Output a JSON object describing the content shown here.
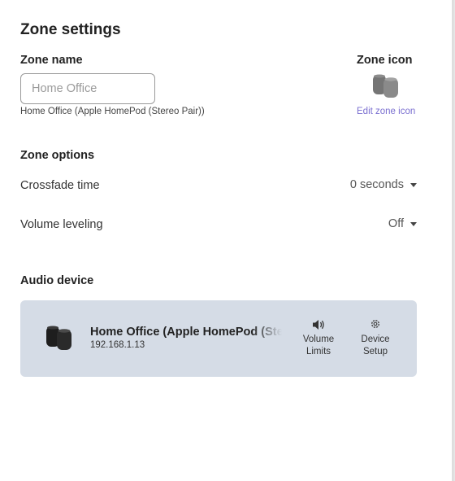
{
  "page": {
    "title": "Zone settings"
  },
  "zone_name": {
    "label": "Zone name",
    "placeholder": "Home Office",
    "hint": "Home Office (Apple HomePod (Stereo Pair))"
  },
  "zone_icon": {
    "label": "Zone icon",
    "icon": "homepod-pair-icon",
    "edit_link": "Edit zone icon"
  },
  "zone_options": {
    "label": "Zone options",
    "crossfade": {
      "label": "Crossfade time",
      "value": "0 seconds"
    },
    "volume_leveling": {
      "label": "Volume leveling",
      "value": "Off"
    }
  },
  "audio_device": {
    "label": "Audio device",
    "device": {
      "icon": "homepod-pair-icon",
      "name": "Home Office (Apple HomePod (Stereo Pair))",
      "ip": "192.168.1.13"
    },
    "actions": {
      "volume_limits": {
        "line1": "Volume",
        "line2": "Limits",
        "icon": "speaker-icon"
      },
      "device_setup": {
        "line1": "Device",
        "line2": "Setup",
        "icon": "gear-icon"
      }
    }
  },
  "colors": {
    "link": "#7a6fd0",
    "card_bg": "#d5dce6"
  }
}
